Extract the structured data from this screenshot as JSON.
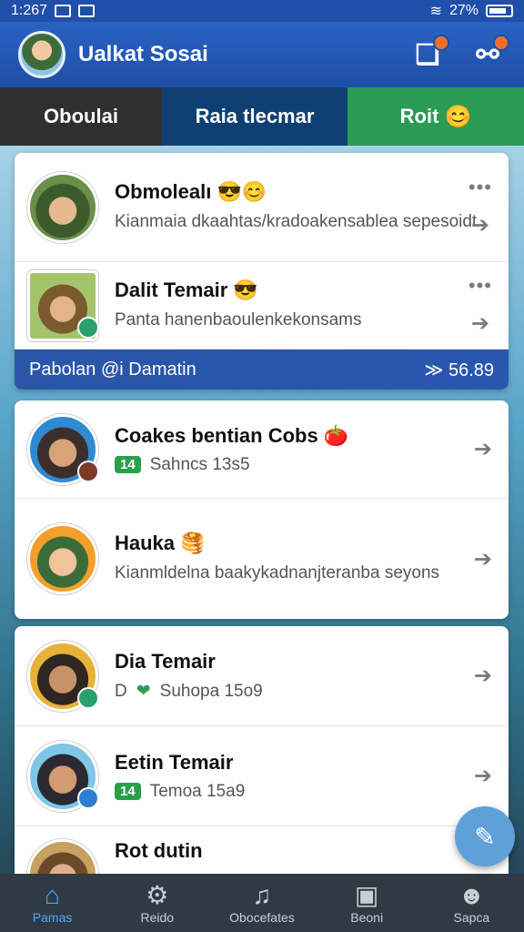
{
  "status_bar": {
    "time": "1:267",
    "battery": "27%"
  },
  "header": {
    "title": "Ualkat Sosai"
  },
  "tabs": [
    {
      "label": "Oboulai"
    },
    {
      "label": "Raia tlecmar"
    },
    {
      "label": "Roit",
      "emoji": "😊"
    }
  ],
  "card1": {
    "rows": [
      {
        "name": "Obmolealı 😎😊",
        "text": "Kianmaia dkaahtas/kradoakensablea sepesoidt."
      },
      {
        "name": "Dalit Temair 😎",
        "text": "Panta hanenbaoulenkekonsams"
      }
    ],
    "banner": {
      "left": "Pabolan @i Damatin",
      "right": "≫ 56.89"
    }
  },
  "card2": {
    "rows": [
      {
        "name": "Coakes bentian Cobs 🍅",
        "tag": "14",
        "meta": "Sahncs 13s5"
      },
      {
        "name": "Hauka 🥞",
        "text": "Kianmldelna baakykadnanjteranba seyons"
      }
    ]
  },
  "card3": {
    "rows": [
      {
        "name": "Dia Temair",
        "prefix": "D",
        "meta": "Suhopa 15o9"
      },
      {
        "name": "Eetin Temair",
        "tag": "14",
        "meta": "Temoa 15a9"
      },
      {
        "name": "Rot dutin"
      }
    ]
  },
  "bottom_nav": [
    {
      "label": "Pamas",
      "icon": "home-icon"
    },
    {
      "label": "Reido",
      "icon": "gear-icon"
    },
    {
      "label": "Obocefates",
      "icon": "music-icon"
    },
    {
      "label": "Beoni",
      "icon": "chat-icon"
    },
    {
      "label": "Sapca",
      "icon": "profile-icon"
    }
  ],
  "colors": {
    "header": "#1e4fa6",
    "accent": "#4ea6f5",
    "badge": "#f0712a"
  }
}
